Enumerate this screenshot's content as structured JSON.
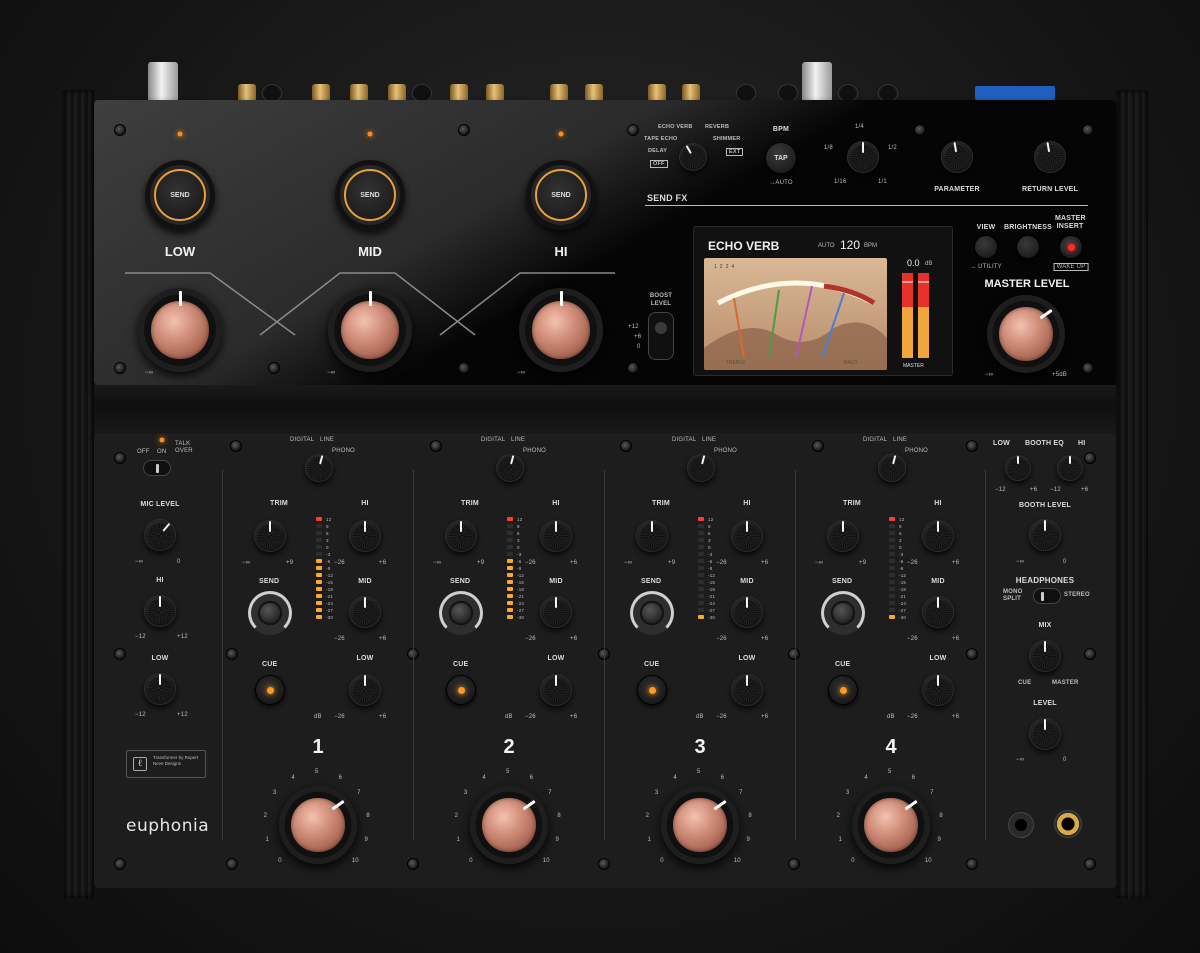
{
  "top": {
    "channels": [
      {
        "label": "LOW",
        "send": "SEND"
      },
      {
        "label": "MID",
        "send": "SEND"
      },
      {
        "label": "HI",
        "send": "SEND"
      }
    ],
    "iso_scale": "−∞",
    "boost": {
      "label": "BOOST LEVEL",
      "values": [
        "+12",
        "+6",
        "0"
      ]
    }
  },
  "fx": {
    "title": "SEND FX",
    "types": [
      "ECHO VERB",
      "REVERB",
      "TAPE ECHO",
      "SHIMMER",
      "DELAY",
      "EXT",
      "OFF"
    ],
    "bpm": {
      "label": "BPM",
      "button": "TAP",
      "sub": "→AUTO"
    },
    "beat": [
      "1/4",
      "1/8",
      "1/2",
      "1/16",
      "1/1"
    ],
    "parameter": "PARAMETER",
    "return_level": "RETURN LEVEL"
  },
  "display": {
    "effect": "ECHO VERB",
    "auto": "AUTO",
    "bpm_value": "120",
    "bpm_unit": "BPM",
    "db_value": "0.0",
    "db_unit": "dB",
    "channel_tags": [
      "1",
      "2",
      "3",
      "4"
    ],
    "footer_left": "TREBLE",
    "footer_mid": "BASS",
    "footer_right": "MASTER"
  },
  "master_section": {
    "view": "VIEW",
    "view_sub": "→ UTILITY",
    "brightness": "BRIGHTNESS",
    "master_insert": "MASTER INSERT",
    "wake_up": "WAKE UP",
    "master_level": "MASTER LEVEL",
    "scale_min": "−∞",
    "scale_max": "+5dB"
  },
  "mic": {
    "off": "OFF",
    "on": "ON",
    "talk_over": "TALK OVER",
    "mic_level": "MIC LEVEL",
    "hi": "HI",
    "low": "LOW",
    "range_min": "−12",
    "range_max": "+12",
    "level_min": "−∞",
    "level_max": "0"
  },
  "credit": "Transformer by Rupert Neve Designs",
  "brand": "euphonia",
  "strip_labels": {
    "digital": "DIGITAL",
    "line": "LINE",
    "phono": "PHONO",
    "trim": "TRIM",
    "trim_min": "−∞",
    "trim_max": "+9",
    "hi": "HI",
    "mid": "MID",
    "low": "LOW",
    "eq_min": "−26",
    "eq_max": "+6",
    "send": "SEND",
    "cue": "CUE",
    "db": "dB"
  },
  "meter_scale": [
    "12",
    "9",
    "6",
    "3",
    "0",
    "-3",
    "-6",
    "-9",
    "-12",
    "-15",
    "-18",
    "-21",
    "-24",
    "-27",
    "-30"
  ],
  "fader_scale": [
    "0",
    "1",
    "2",
    "3",
    "4",
    "5",
    "6",
    "7",
    "8",
    "9",
    "10"
  ],
  "channels": [
    {
      "number": "1"
    },
    {
      "number": "2"
    },
    {
      "number": "3"
    },
    {
      "number": "4"
    }
  ],
  "booth": {
    "low": "LOW",
    "booth_eq": "BOOTH EQ",
    "hi": "HI",
    "eq_min": "−12",
    "eq_max": "+6",
    "booth_level": "BOOTH LEVEL",
    "level_min": "−∞",
    "level_max": "0",
    "headphones": "HEADPHONES",
    "mono_split": "MONO SPLIT",
    "stereo": "STEREO",
    "mix": "MIX",
    "cue": "CUE",
    "master": "MASTER",
    "level": "LEVEL"
  },
  "colors": {
    "accent_orange": "#ff9a22",
    "copper": "#d3917d",
    "panel": "#1d1d1d"
  }
}
